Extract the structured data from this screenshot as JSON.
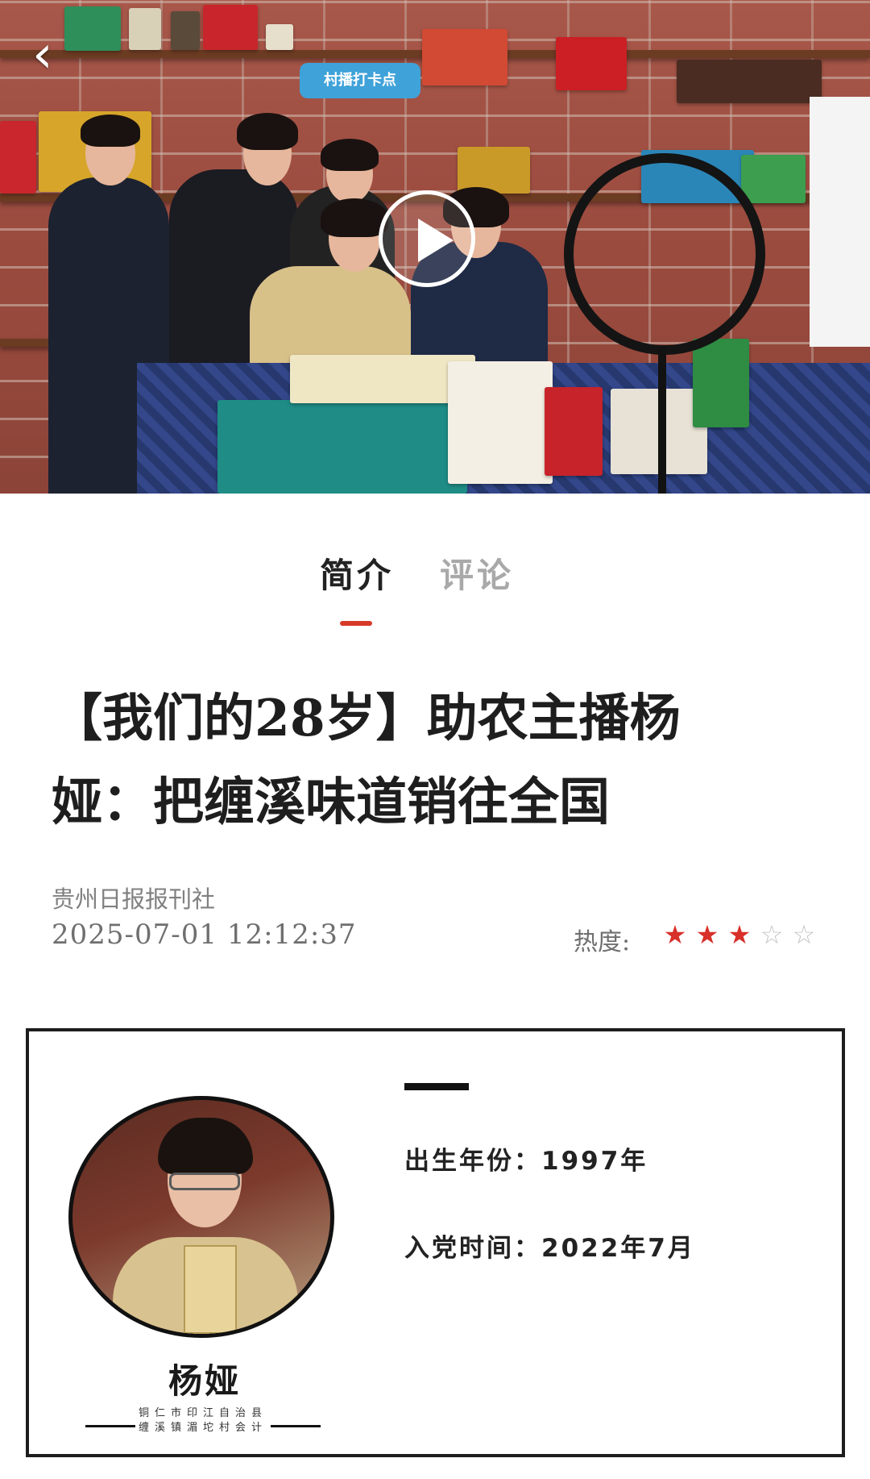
{
  "hero": {
    "sign_text": "村播打卡点",
    "back_icon": "chevron-left-icon",
    "play_icon": "play-icon"
  },
  "tabs": [
    {
      "label": "简介",
      "active": true
    },
    {
      "label": "评论",
      "active": false
    }
  ],
  "article": {
    "title_line1": "【我们的28岁】助农主播杨",
    "title_line2": "娅：把缠溪味道销往全国",
    "source": "贵州日报报刊社",
    "datetime": "2025-07-01  12:12:37",
    "heat_label": "热度:",
    "heat_rating": 2.5,
    "heat_max": 5
  },
  "profile": {
    "name": "杨娅",
    "org_line1": "铜仁市印江自治县",
    "org_line2": "缠溪镇湄坨村会计",
    "birth_year": "出生年份：1997年",
    "party_join": "入党时间：2022年7月"
  },
  "colors": {
    "accent": "#d83a2a",
    "tab_inactive": "#a9a9a9",
    "meta_text": "#6f6f6f"
  }
}
